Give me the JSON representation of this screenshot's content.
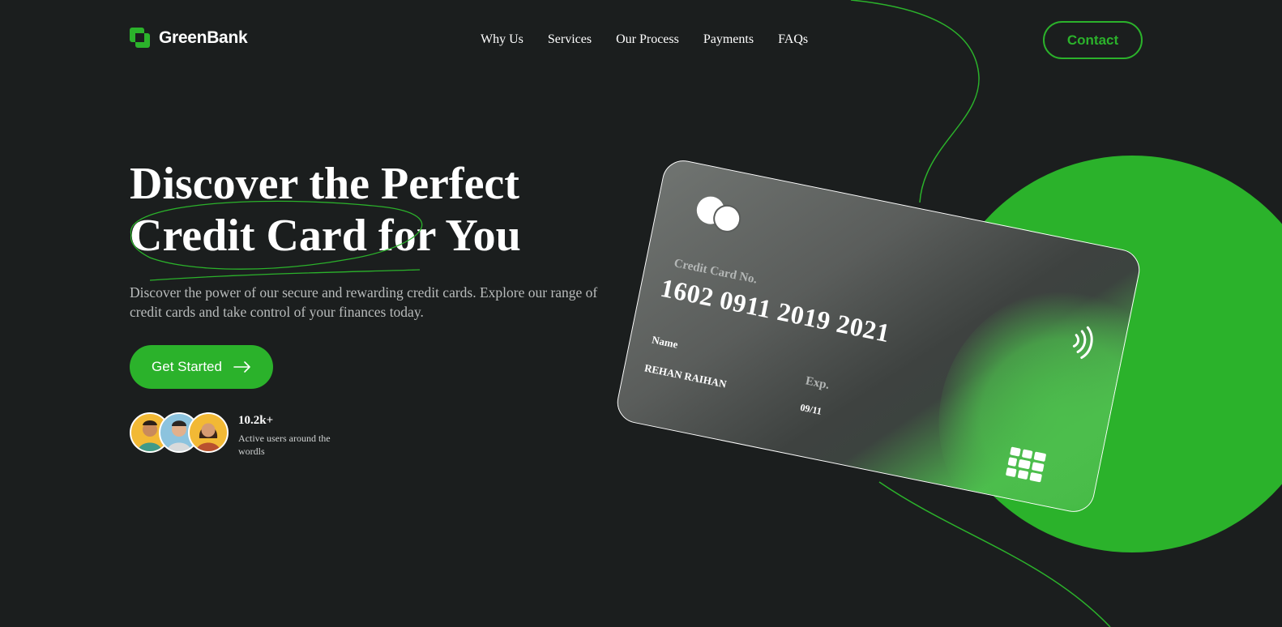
{
  "header": {
    "brand": "GreenBank",
    "nav": [
      "Why Us",
      "Services",
      "Our Process",
      "Payments",
      "FAQs"
    ],
    "contact_label": "Contact"
  },
  "hero": {
    "title_line1": "Discover the Perfect",
    "title_line2": "Credit Card for You",
    "subtitle": "Discover the power of our secure and rewarding credit cards. Explore our range of credit cards and take control of your finances today.",
    "cta_label": "Get Started",
    "users_count": "10.2k+",
    "users_label": "Active users around the wordls"
  },
  "card": {
    "number_label": "Credit Card No.",
    "number": "1602 0911 2019 2021",
    "name_label": "Name",
    "holder": "REHAN RAIHAN",
    "exp_label": "Exp.",
    "exp": "09/11"
  },
  "icons": {
    "logo": "greenbank-logo-icon",
    "cta": "arrow-right-icon",
    "card_brand": "card-network-icon",
    "contactless": "contactless-icon",
    "chip": "chip-icon"
  },
  "colors": {
    "background": "#1b1e1e",
    "accent": "#2bb22b",
    "text": "#ffffff",
    "muted": "#b9bcbc"
  }
}
